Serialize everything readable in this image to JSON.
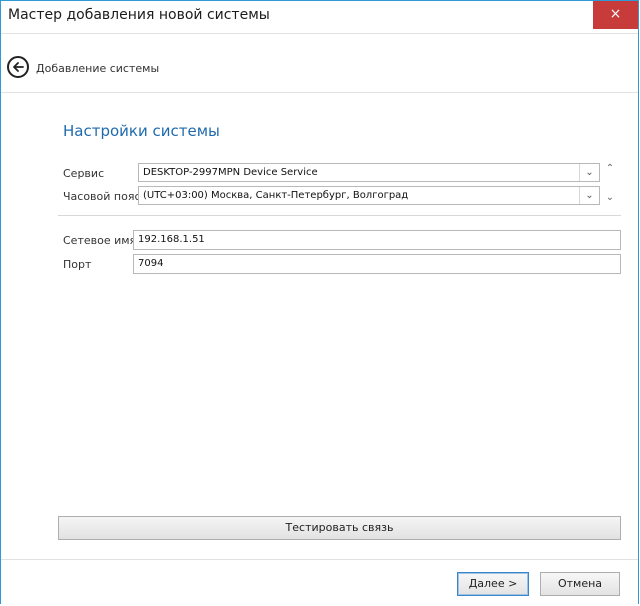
{
  "window": {
    "title": "Мастер добавления новой системы",
    "close_glyph": "×"
  },
  "nav": {
    "title": "Добавление системы",
    "back_icon": "arrow-left-circle-icon"
  },
  "section": {
    "title": "Настройки системы"
  },
  "fields": {
    "service": {
      "label": "Сервис",
      "value": "DESKTOP-2997MPN Device Service"
    },
    "timezone": {
      "label": "Часовой пояс",
      "value": "(UTC+03:00) Москва, Санкт-Петербург, Волгоград"
    },
    "network_name": {
      "label": "Сетевое имя",
      "value": "192.168.1.51"
    },
    "port": {
      "label": "Порт",
      "value": "7094"
    }
  },
  "glyphs": {
    "dropdown": "⌄",
    "scroll_up": "⌃",
    "scroll_down": "⌄"
  },
  "buttons": {
    "test_connection": "Тестировать связь",
    "next": "Далее >",
    "cancel": "Отмена"
  },
  "colors": {
    "accent": "#1f6aae",
    "close": "#c73b3a",
    "window_border": "#2f9ad6"
  }
}
